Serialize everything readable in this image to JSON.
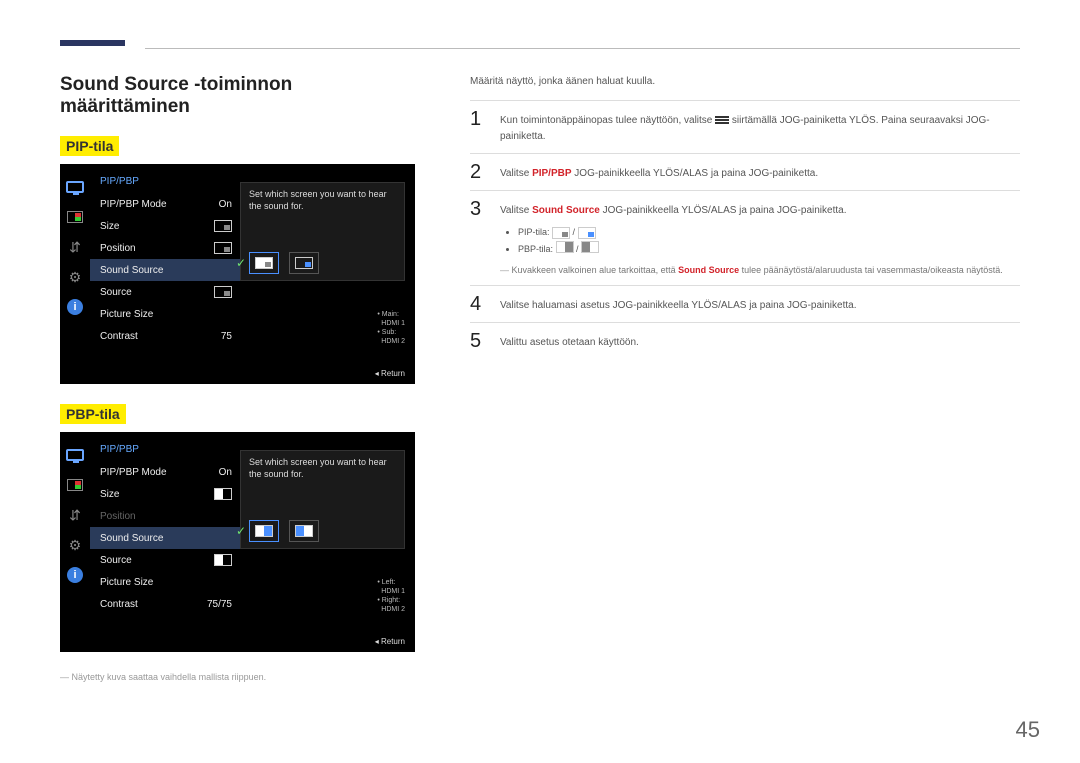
{
  "page": {
    "title": "Sound Source -toiminnon määrittäminen",
    "mode1_label": "PIP-tila",
    "mode2_label": "PBP-tila",
    "page_number": "45",
    "disclaimer": "― Näytetty kuva saattaa vaihdella mallista riippuen."
  },
  "osd": {
    "menu_title": "PIP/PBP",
    "rows": {
      "mode": "PIP/PBP Mode",
      "mode_val": "On",
      "size": "Size",
      "position": "Position",
      "sound": "Sound Source",
      "source": "Source",
      "picsize": "Picture Size",
      "contrast": "Contrast",
      "contrast_val_pip": "75",
      "contrast_val_pbp": "75/75"
    },
    "popup_desc": "Set which screen you want to hear the sound for.",
    "info_pip": {
      "a": "Main:",
      "a_val": "HDMI 1",
      "b": "Sub:",
      "b_val": "HDMI 2"
    },
    "info_pbp": {
      "a": "Left:",
      "a_val": "HDMI 1",
      "b": "Right:",
      "b_val": "HDMI 2"
    },
    "return": "Return"
  },
  "right": {
    "intro": "Määritä näyttö, jonka äänen haluat kuulla.",
    "step1_a": "Kun toimintonäppäinopas tulee näyttöön, valitse ",
    "step1_b": " siirtämällä JOG-painiketta YLÖS. Paina seuraavaksi JOG-painiketta.",
    "step2_a": "Valitse ",
    "step2_link": "PIP/PBP",
    "step2_b": " JOG-painikkeella YLÖS/ALAS ja paina JOG-painiketta.",
    "step3_a": "Valitse ",
    "step3_link": "Sound Source",
    "step3_b": " JOG-painikkeella YLÖS/ALAS ja paina JOG-painiketta.",
    "bullet_pip": "PIP-tila:",
    "bullet_pbp": "PBP-tila:",
    "note_a": "Kuvakkeen valkoinen alue tarkoittaa, että ",
    "note_link": "Sound Source",
    "note_b": " tulee päänäytöstä/alaruudusta tai vasemmasta/oikeasta näytöstä.",
    "step4": "Valitse haluamasi asetus JOG-painikkeella YLÖS/ALAS ja paina JOG-painiketta.",
    "step5": "Valittu asetus otetaan käyttöön."
  }
}
